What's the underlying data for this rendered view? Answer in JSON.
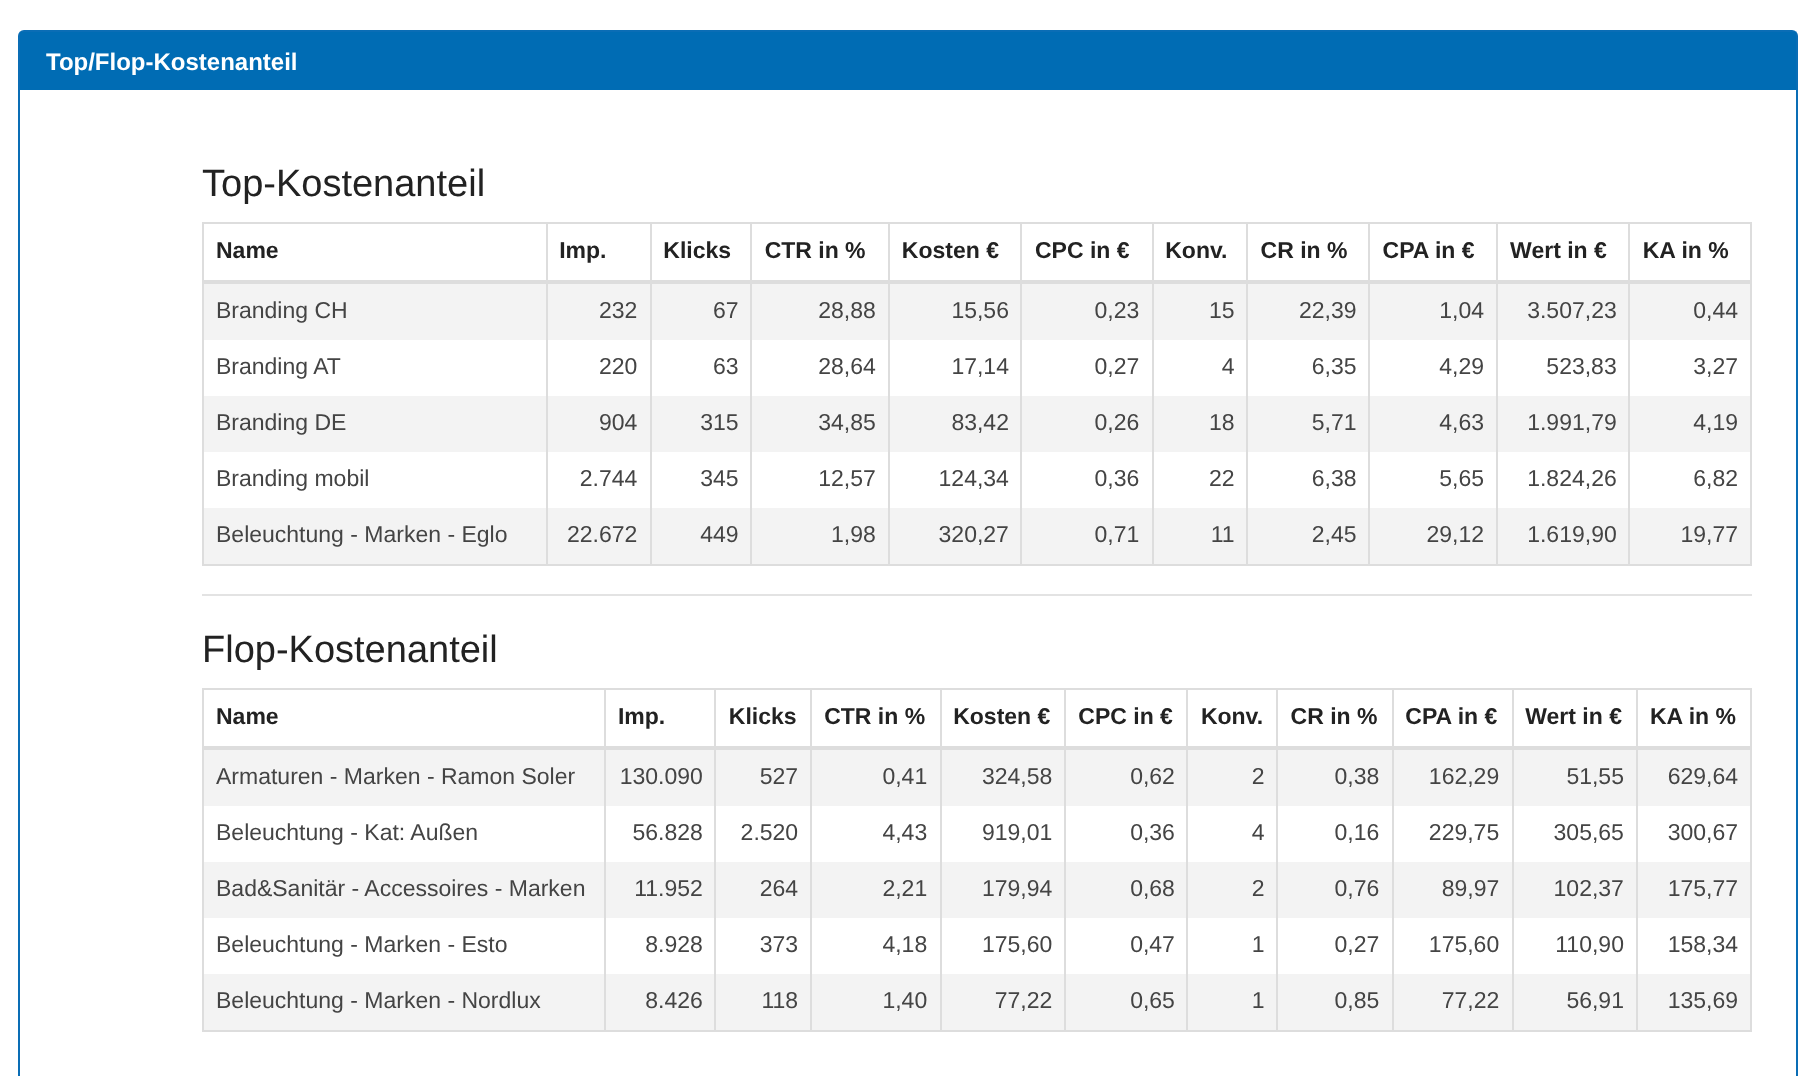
{
  "panel": {
    "title": "Top/Flop-Kostenanteil"
  },
  "sections": [
    {
      "title": "Top-Kostenanteil",
      "columns": [
        "Name",
        "Imp.",
        "Klicks",
        "CTR in %",
        "Kosten €",
        "CPC in €",
        "Konv.",
        "CR in %",
        "CPA in €",
        "Wert in €",
        "KA in %"
      ],
      "rows": [
        [
          "Branding CH",
          "232",
          "67",
          "28,88",
          "15,56",
          "0,23",
          "15",
          "22,39",
          "1,04",
          "3.507,23",
          "0,44"
        ],
        [
          "Branding AT",
          "220",
          "63",
          "28,64",
          "17,14",
          "0,27",
          "4",
          "6,35",
          "4,29",
          "523,83",
          "3,27"
        ],
        [
          "Branding DE",
          "904",
          "315",
          "34,85",
          "83,42",
          "0,26",
          "18",
          "5,71",
          "4,63",
          "1.991,79",
          "4,19"
        ],
        [
          "Branding mobil",
          "2.744",
          "345",
          "12,57",
          "124,34",
          "0,36",
          "22",
          "6,38",
          "5,65",
          "1.824,26",
          "6,82"
        ],
        [
          "Beleuchtung - Marken - Eglo",
          "22.672",
          "449",
          "1,98",
          "320,27",
          "0,71",
          "11",
          "2,45",
          "29,12",
          "1.619,90",
          "19,77"
        ]
      ]
    },
    {
      "title": "Flop-Kostenanteil",
      "columns": [
        "Name",
        "Imp.",
        "Klicks",
        "CTR in %",
        "Kosten €",
        "CPC in €",
        "Konv.",
        "CR in %",
        "CPA in €",
        "Wert in €",
        "KA in %"
      ],
      "rows": [
        [
          "Armaturen - Marken - Ramon Soler",
          "130.090",
          "527",
          "0,41",
          "324,58",
          "0,62",
          "2",
          "0,38",
          "162,29",
          "51,55",
          "629,64"
        ],
        [
          "Beleuchtung - Kat: Außen",
          "56.828",
          "2.520",
          "4,43",
          "919,01",
          "0,36",
          "4",
          "0,16",
          "229,75",
          "305,65",
          "300,67"
        ],
        [
          "Bad&Sanitär - Accessoires - Marken",
          "11.952",
          "264",
          "2,21",
          "179,94",
          "0,68",
          "2",
          "0,76",
          "89,97",
          "102,37",
          "175,77"
        ],
        [
          "Beleuchtung - Marken - Esto",
          "8.928",
          "373",
          "4,18",
          "175,60",
          "0,47",
          "1",
          "0,27",
          "175,60",
          "110,90",
          "158,34"
        ],
        [
          "Beleuchtung - Marken - Nordlux",
          "8.426",
          "118",
          "1,40",
          "77,22",
          "0,65",
          "1",
          "0,85",
          "77,22",
          "56,91",
          "135,69"
        ]
      ]
    }
  ]
}
